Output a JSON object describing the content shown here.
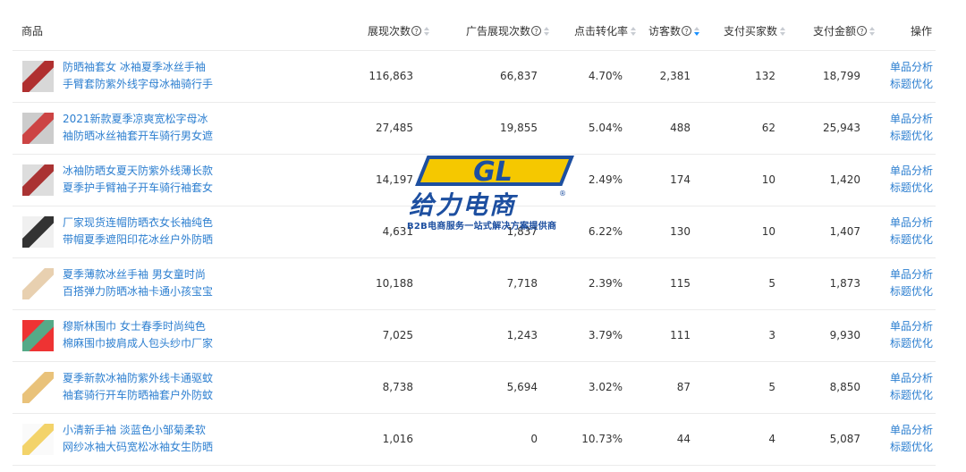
{
  "colors": {
    "link": "#2d7fd0",
    "border": "#ebebeb",
    "sort_active": "#1890ff",
    "brand_blue": "#1d4fa0",
    "brand_yellow": "#f5c800"
  },
  "header": {
    "product": "商品",
    "impressions": "展现次数",
    "ad_impressions": "广告展现次数",
    "ctr": "点击转化率",
    "visitors": "访客数",
    "buyers": "支付买家数",
    "amount": "支付金额",
    "ops": "操作",
    "help_icon_glyph": "?"
  },
  "ops_labels": {
    "analysis": "单品分析",
    "title_opt": "标题优化"
  },
  "rows": [
    {
      "name": "防晒袖套女 冰袖夏季冰丝手袖手臂套防紫外线字母冰袖骑行手",
      "impressions": "116,863",
      "ad_impressions": "66,837",
      "ctr": "4.70%",
      "visitors": "2,381",
      "buyers": "132",
      "amount": "18,799"
    },
    {
      "name": "2021新款夏季凉爽宽松字母冰袖防晒冰丝袖套开车骑行男女遮",
      "impressions": "27,485",
      "ad_impressions": "19,855",
      "ctr": "5.04%",
      "visitors": "488",
      "buyers": "62",
      "amount": "25,943"
    },
    {
      "name": "冰袖防晒女夏天防紫外线薄长款夏季护手臂袖子开车骑行袖套女",
      "impressions": "14,197",
      "ad_impressions": "",
      "ctr": "2.49%",
      "visitors": "174",
      "buyers": "10",
      "amount": "1,420"
    },
    {
      "name": "厂家现货连帽防晒衣女长袖纯色带帽夏季遮阳印花冰丝户外防晒",
      "impressions": "4,631",
      "ad_impressions": "1,837",
      "ctr": "6.22%",
      "visitors": "130",
      "buyers": "10",
      "amount": "1,407"
    },
    {
      "name": "夏季薄款冰丝手袖 男女童时尚百搭弹力防晒冰袖卡通小孩宝宝",
      "impressions": "10,188",
      "ad_impressions": "7,718",
      "ctr": "2.39%",
      "visitors": "115",
      "buyers": "5",
      "amount": "1,873"
    },
    {
      "name": "穆斯林围巾 女士春季时尚纯色棉麻围巾披肩成人包头纱巾厂家",
      "impressions": "7,025",
      "ad_impressions": "1,243",
      "ctr": "3.79%",
      "visitors": "111",
      "buyers": "3",
      "amount": "9,930"
    },
    {
      "name": "夏季新款冰袖防紫外线卡通驱蚊袖套骑行开车防晒袖套户外防蚊",
      "impressions": "8,738",
      "ad_impressions": "5,694",
      "ctr": "3.02%",
      "visitors": "87",
      "buyers": "5",
      "amount": "8,850"
    },
    {
      "name": "小清新手袖 淡蓝色小邹菊柔软网纱冰袖大码宽松冰袖女生防晒",
      "impressions": "1,016",
      "ad_impressions": "0",
      "ctr": "10.73%",
      "visitors": "44",
      "buyers": "4",
      "amount": "5,087"
    }
  ],
  "watermark": {
    "logo_letters": "GL",
    "cn_name": "给力电商",
    "tagline": "B2B电商服务一站式解决方案提供商",
    "reg": "®"
  }
}
